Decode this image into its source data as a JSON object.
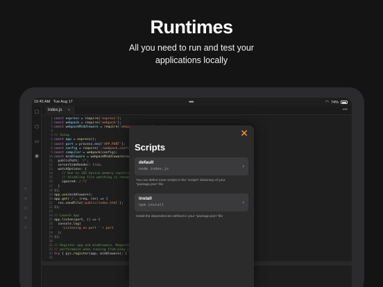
{
  "hero": {
    "title": "Runtimes",
    "subtitle_line1": "All you need to run and test your",
    "subtitle_line2": "applications locally"
  },
  "status_bar": {
    "time": "10:45 AM",
    "date": "Tue Aug 17",
    "battery": "74%"
  },
  "editor": {
    "tab_name": "index.js",
    "line_numbers": [
      "1",
      "2",
      "3",
      "4",
      "5",
      "6",
      "7",
      "8",
      "9",
      "10",
      "11",
      "12",
      "13",
      "14",
      "15",
      "16",
      "17",
      "18",
      "19",
      "20",
      "21",
      "22",
      "23",
      "24",
      "25",
      "26",
      "27",
      "28",
      "29",
      "30",
      "31",
      "32",
      "33",
      "34"
    ]
  },
  "modal": {
    "title": "Scripts",
    "scripts": [
      {
        "name": "default",
        "command": "node index.js"
      },
      {
        "name": "install",
        "command": "npm install"
      }
    ],
    "hint_default_line1": "You can define more scripts in the \"scripts\" dictionary of your",
    "hint_default_line2": "\"package.json\" file",
    "hint_install": "Install the dependencies defined in your \"package.json\" file"
  },
  "colors": {
    "accent": "#ff9f3a",
    "background": "#141414",
    "modal_bg": "#2b2b2b",
    "card_bg": "#3a3a3c"
  }
}
